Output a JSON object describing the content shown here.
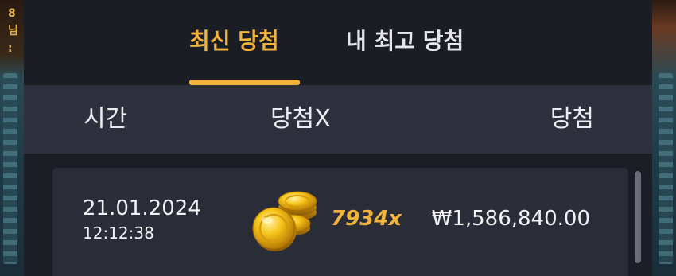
{
  "background": {
    "left_text": "8\n님\n:"
  },
  "tabs": [
    {
      "label": "최신 당첨",
      "active": true
    },
    {
      "label": "내 최고 당첨",
      "active": false
    }
  ],
  "table": {
    "headers": {
      "time": "시간",
      "multiplier": "당첨X",
      "win": "당첨"
    },
    "rows": [
      {
        "date": "21.01.2024",
        "time": "12:12:38",
        "icon": "gold-coins-icon",
        "multiplier": "7934x",
        "amount": "₩1,586,840.00"
      }
    ]
  },
  "colors": {
    "accent": "#f0b43c",
    "panel": "#22252e",
    "header_bg": "#2e313d",
    "row_bg": "#2a2d38",
    "text": "#f2f2f4"
  }
}
